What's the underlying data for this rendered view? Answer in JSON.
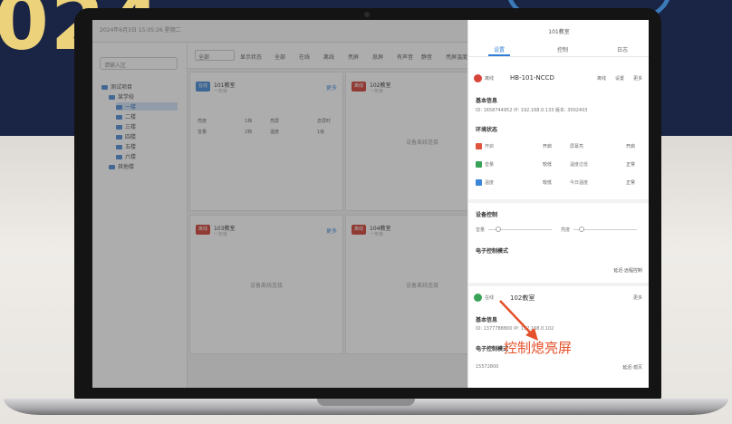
{
  "backdrop": {
    "title_fragment": "024"
  },
  "app": {
    "header_text": "2024年6月3日 15:05:26 星期二",
    "tree": {
      "search_placeholder": "请输入区",
      "nodes": [
        {
          "label": "测试项目",
          "level": 0,
          "selected": false
        },
        {
          "label": "某学校",
          "level": 1,
          "selected": false
        },
        {
          "label": "一楼",
          "level": 2,
          "selected": true
        },
        {
          "label": "二楼",
          "level": 2,
          "selected": false
        },
        {
          "label": "三楼",
          "level": 2,
          "selected": false
        },
        {
          "label": "四楼",
          "level": 2,
          "selected": false
        },
        {
          "label": "五楼",
          "level": 2,
          "selected": false
        },
        {
          "label": "六楼",
          "level": 2,
          "selected": false
        },
        {
          "label": "其他楼",
          "level": 1,
          "selected": false
        }
      ]
    },
    "filter": {
      "select_value": "全部",
      "label": "显示状态",
      "options": [
        "全部",
        "在线",
        "离线",
        "亮屏",
        "息屏",
        "有声音",
        "静音",
        "亮屏温度"
      ]
    },
    "cards": [
      {
        "badge": "在线",
        "badge_color": "#3b86d6",
        "name": "101教室",
        "sub": "一年级",
        "link": "更多",
        "lines": [
          "亮度",
          "1档",
          "音量",
          "2档",
          "亮屏",
          "息屏时",
          "温度",
          "1级"
        ],
        "empty": ""
      },
      {
        "badge": "离线",
        "badge_color": "#cf3a2f",
        "name": "102教室",
        "sub": "一年级",
        "link": "",
        "lines": [],
        "empty": "设备离线连接"
      },
      {
        "badge": "离线",
        "badge_color": "#cf3a2f",
        "name": "103教室",
        "sub": "一年级",
        "link": "更多",
        "lines": [],
        "empty": "设备离线连接"
      },
      {
        "badge": "离线",
        "badge_color": "#cf3a2f",
        "name": "104教室",
        "sub": "一年级",
        "link": "",
        "lines": [],
        "empty": "设备离线连接"
      }
    ]
  },
  "panel": {
    "title": "101教室",
    "tabs": [
      "设置",
      "控制",
      "日志"
    ],
    "device1": {
      "status": "离线",
      "id": "HB-101-NCCD",
      "right": [
        "离线",
        "设置",
        "更多"
      ],
      "status_color": "#d9443a"
    },
    "basic_info": {
      "heading": "基本信息",
      "line": "ID: 1658744952    IP: 192.168.0.133    版本: 3002403"
    },
    "env": {
      "heading": "环境状态",
      "rows": [
        {
          "l1": "开启",
          "v1": "开启",
          "l2": "屏幕亮",
          "v2": "开启"
        },
        {
          "l1": "音量",
          "v1": "较低",
          "l2": "温度过低",
          "v2": "正常"
        },
        {
          "l1": "温度",
          "v1": "较低",
          "l2": "今日温度",
          "v2": "正常"
        }
      ]
    },
    "volume": {
      "heading": "设备控制",
      "l1": "音量",
      "l2": "亮度"
    },
    "power": {
      "heading": "电子控制模式",
      "right": "延迟·远程控制"
    },
    "device2": {
      "status": "在线",
      "id": "102教室",
      "right": "更多",
      "status_color": "#3aa35a"
    },
    "basic_info2": {
      "heading": "基本信息",
      "line": "ID: 1377788800    IP: 192.168.0.102"
    },
    "power2": {
      "heading": "电子控制模式",
      "value": "15572800",
      "right": "延迟·熄灭"
    }
  },
  "annotation": {
    "text": "控制熄亮屏",
    "color": "#e4512a"
  }
}
